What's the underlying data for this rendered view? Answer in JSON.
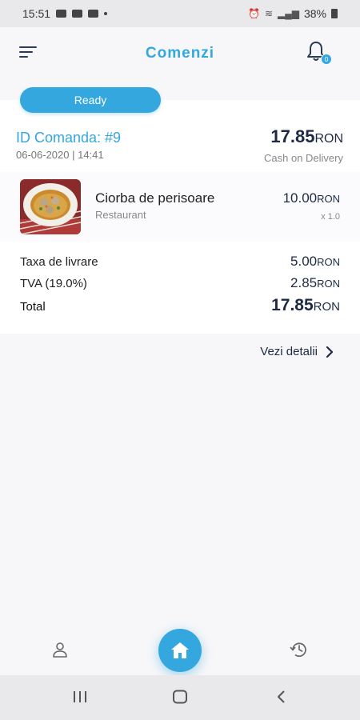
{
  "status_bar": {
    "time": "15:51",
    "battery": "38%"
  },
  "header": {
    "title": "Comenzi",
    "notification_count": "0"
  },
  "order": {
    "status": "Ready",
    "id_label": "ID Comanda: #9",
    "date": "06-06-2020 | 14:41",
    "total_amount": "17.85",
    "currency": "RON",
    "payment_method": "Cash on Delivery",
    "item": {
      "name": "Ciorba de perisoare",
      "source": "Restaurant",
      "price": "10.00",
      "quantity": "x 1.0"
    },
    "summary": [
      {
        "label": "Taxa de livrare",
        "value": "5.00"
      },
      {
        "label": "TVA (19.0%)",
        "value": "2.85"
      }
    ],
    "total_label": "Total",
    "total_value": "17.85",
    "details_link": "Vezi detalii"
  },
  "colors": {
    "accent": "#35a7df",
    "dark_text": "#1e2a44"
  },
  "icons": {
    "menu": "menu-icon",
    "bell": "bell-icon",
    "profile": "user-icon",
    "home": "home-icon",
    "history": "history-icon"
  }
}
